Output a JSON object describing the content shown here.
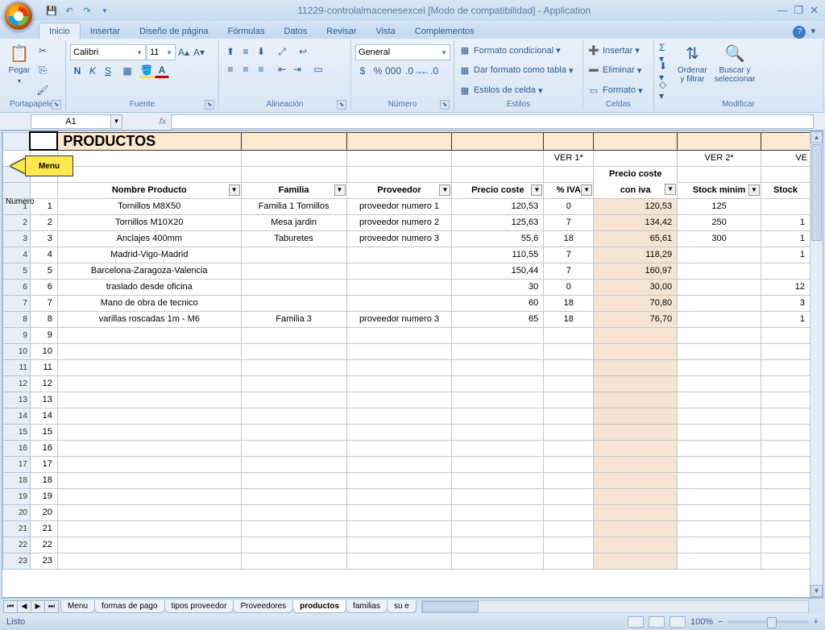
{
  "title": "11229-controlalmacenesexcel  [Modo de compatibilidad] - Application",
  "tabs": [
    "Inicio",
    "Insertar",
    "Diseño de página",
    "Fórmulas",
    "Datos",
    "Revisar",
    "Vista",
    "Complementos"
  ],
  "activeTab": 0,
  "namebox": "A1",
  "ribbon": {
    "clipboard": {
      "paste": "Pegar",
      "label": "Portapapeles"
    },
    "font": {
      "name": "Calibri",
      "size": "11",
      "label": "Fuente"
    },
    "align": {
      "label": "Alineación"
    },
    "number": {
      "format": "General",
      "label": "Número"
    },
    "styles": {
      "cond": "Formato condicional",
      "table": "Dar formato como tabla",
      "cell": "Estilos de celda",
      "label": "Estilos"
    },
    "cells": {
      "ins": "Insertar",
      "del": "Eliminar",
      "fmt": "Formato",
      "label": "Celdas"
    },
    "edit": {
      "sort": "Ordenar\ny filtrar",
      "find": "Buscar y\nseleccionar",
      "label": "Modificar"
    }
  },
  "sheet": {
    "bigTitle": "PRODUCTOS",
    "menuLabel": "Menu",
    "numeroLabel": "Numero",
    "ver1": "VER 1*",
    "ver2": "VER 2*",
    "ver3": "VE",
    "headers": {
      "nombre": "Nombre Producto",
      "familia": "Familia",
      "proveedor": "Proveedor",
      "precio": "Precio coste",
      "iva": "% IVA",
      "precioiva1": "Precio coste",
      "precioiva2": "con iva",
      "stockmin": "Stock minim",
      "stock": "Stock"
    },
    "rows": [
      {
        "n": "1",
        "nombre": "Tornillos M8X50",
        "familia": "Familia 1 Tornillos",
        "proveedor": "proveedor numero 1",
        "precio": "120,53",
        "iva": "0",
        "precioiva": "120,53",
        "stockmin": "125",
        "stock": ""
      },
      {
        "n": "2",
        "nombre": "Tornillos M10X20",
        "familia": "Mesa jardin",
        "proveedor": "proveedor numero 2",
        "precio": "125,63",
        "iva": "7",
        "precioiva": "134,42",
        "stockmin": "250",
        "stock": "1"
      },
      {
        "n": "3",
        "nombre": "Anclajes 400mm",
        "familia": "Taburetes",
        "proveedor": "proveedor numero 3",
        "precio": "55,6",
        "iva": "18",
        "precioiva": "65,61",
        "stockmin": "300",
        "stock": "1"
      },
      {
        "n": "4",
        "nombre": "Madrid-Vigo-Madrid",
        "familia": "",
        "proveedor": "",
        "precio": "110,55",
        "iva": "7",
        "precioiva": "118,29",
        "stockmin": "",
        "stock": "1"
      },
      {
        "n": "5",
        "nombre": "Barcelona-Zaragoza-Valencia",
        "familia": "",
        "proveedor": "",
        "precio": "150,44",
        "iva": "7",
        "precioiva": "160,97",
        "stockmin": "",
        "stock": ""
      },
      {
        "n": "6",
        "nombre": "traslado desde oficina",
        "familia": "",
        "proveedor": "",
        "precio": "30",
        "iva": "0",
        "precioiva": "30,00",
        "stockmin": "",
        "stock": "12"
      },
      {
        "n": "7",
        "nombre": "Mano de obra de tecnico",
        "familia": "",
        "proveedor": "",
        "precio": "60",
        "iva": "18",
        "precioiva": "70,80",
        "stockmin": "",
        "stock": "3"
      },
      {
        "n": "8",
        "nombre": "varillas roscadas 1m - M6",
        "familia": "Familia 3",
        "proveedor": "proveedor numero 3",
        "precio": "65",
        "iva": "18",
        "precioiva": "76,70",
        "stockmin": "",
        "stock": "1"
      }
    ],
    "emptyRows": [
      "9",
      "10",
      "11",
      "12",
      "13",
      "14",
      "15",
      "16",
      "17",
      "18",
      "19",
      "20",
      "21",
      "22",
      "23"
    ]
  },
  "sheetTabs": [
    "Menu",
    "formas de pago",
    "tipos proveedor",
    "Proveedores",
    "productos",
    "familias",
    "su e"
  ],
  "activeSheet": 4,
  "status": {
    "ready": "Listo",
    "zoom": "100%"
  }
}
